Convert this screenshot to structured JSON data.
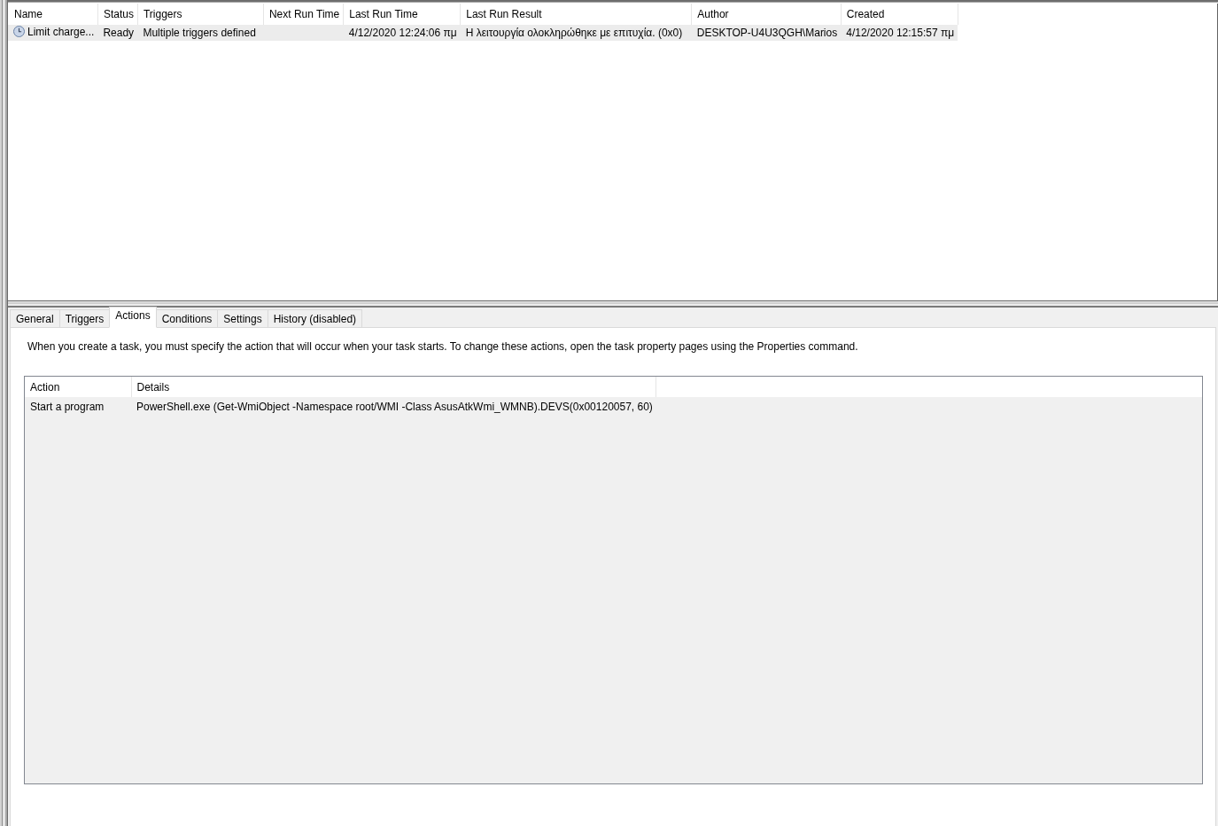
{
  "task_list": {
    "columns": [
      "Name",
      "Status",
      "Triggers",
      "Next Run Time",
      "Last Run Time",
      "Last Run Result",
      "Author",
      "Created"
    ],
    "rows": [
      {
        "selected": true,
        "name": "Limit charge...",
        "status": "Ready",
        "triggers": "Multiple triggers defined",
        "last_run_time": "4/12/2020 12:24:06 πμ",
        "last_run_result": "Η λειτουργία ολοκληρώθηκε με επιτυχία. (0x0)",
        "author": "DESKTOP-U4U3QGH\\Marios",
        "created": "4/12/2020 12:15:57 πμ"
      }
    ]
  },
  "details_pane": {
    "tabs": [
      {
        "label": "General",
        "selected": false
      },
      {
        "label": "Triggers",
        "selected": false
      },
      {
        "label": "Actions",
        "selected": true
      },
      {
        "label": "Conditions",
        "selected": false
      },
      {
        "label": "Settings",
        "selected": false
      },
      {
        "label": "History (disabled)",
        "selected": false
      }
    ],
    "description": "When you create a task, you must specify the action that will occur when your task starts.  To change these actions, open the task property pages using the Properties command.",
    "actions": {
      "columns": [
        "Action",
        "Details"
      ],
      "rows": [
        {
          "action": "Start a program",
          "details": "PowerShell.exe (Get-WmiObject -Namespace root/WMI -Class AsusAtkWmi_WMNB).DEVS(0x00120057, 60)"
        }
      ]
    }
  }
}
